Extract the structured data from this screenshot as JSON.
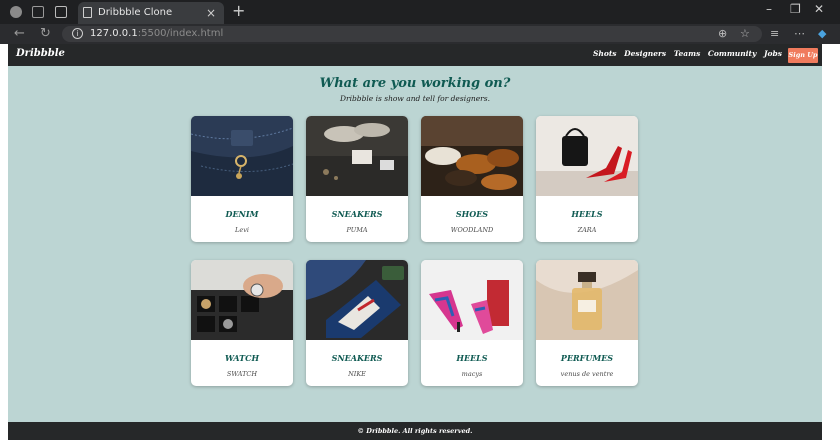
{
  "browser": {
    "tab_title": "Dribbble Clone",
    "url_host": "127.0.0.1",
    "url_rest": ":5500/index.html"
  },
  "nav": {
    "brand": "Dribbble",
    "links": [
      "Shots",
      "Designers",
      "Teams",
      "Community",
      "Jobs"
    ],
    "signup": "Sign Up"
  },
  "hero": {
    "title": "What are you working on?",
    "subtitle": "Dribbble is show and tell for designers."
  },
  "cards": [
    {
      "title": "DENIM",
      "brand": "Levi"
    },
    {
      "title": "SNEAKERS",
      "brand": "PUMA"
    },
    {
      "title": "SHOES",
      "brand": "WOODLAND"
    },
    {
      "title": "HEELS",
      "brand": "ZARA"
    },
    {
      "title": "WATCH",
      "brand": "SWATCH"
    },
    {
      "title": "SNEAKERS",
      "brand": "NIKE"
    },
    {
      "title": "HEELS",
      "brand": "macys"
    },
    {
      "title": "PERFUMES",
      "brand": "venus de ventre"
    }
  ],
  "footer": {
    "text": "© Dribbble. All rights reserved."
  },
  "colors": {
    "background": "#bcd5d3",
    "navbar": "#262829",
    "accent": "#0f5a52",
    "signup": "#f07b5d"
  }
}
